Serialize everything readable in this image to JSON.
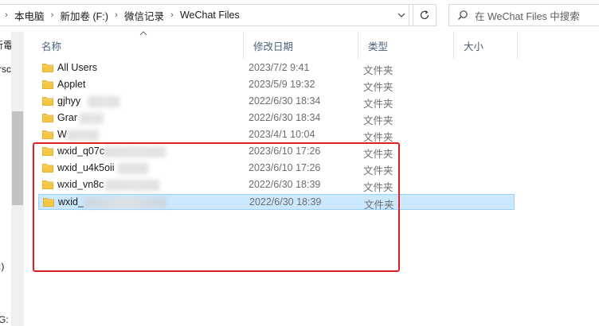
{
  "address": {
    "crumbs": [
      "本电脑",
      "新加卷 (F:)",
      "微信记录",
      "WeChat Files"
    ],
    "separator": "›"
  },
  "search": {
    "placeholder": "在 WeChat Files 中搜索"
  },
  "nav": {
    "fragments": [
      "新電",
      "rsc",
      ":)",
      "G:"
    ]
  },
  "columns": {
    "name": "名称",
    "date": "修改日期",
    "type": "类型",
    "size": "大小"
  },
  "files": [
    {
      "name": "All Users",
      "date": "2023/7/2 9:41",
      "type": "文件夹",
      "selected": false
    },
    {
      "name": "Applet",
      "date": "2023/5/9 19:32",
      "type": "文件夹",
      "selected": false
    },
    {
      "name": "gjhyy",
      "date": "2022/6/30 18:34",
      "type": "文件夹",
      "selected": false
    },
    {
      "name": "Grar",
      "date": "2022/6/30 18:34",
      "type": "文件夹",
      "selected": false
    },
    {
      "name": "W",
      "date": "2023/4/1 10:04",
      "type": "文件夹",
      "selected": false
    },
    {
      "name": "wxid_q07c",
      "date": "2023/6/10 17:26",
      "type": "文件夹",
      "selected": false
    },
    {
      "name": "wxid_u4k5oii",
      "date": "2023/6/10 17:26",
      "type": "文件夹",
      "selected": false
    },
    {
      "name": "wxid_vn8c",
      "date": "2022/6/30 18:39",
      "type": "文件夹",
      "selected": false
    },
    {
      "name": "wxid_",
      "date": "2022/6/30 18:39",
      "type": "文件夹",
      "selected": true
    }
  ],
  "colors": {
    "folder": "#f5c642",
    "selection": "#cce8ff",
    "annotation": "#e02020"
  }
}
